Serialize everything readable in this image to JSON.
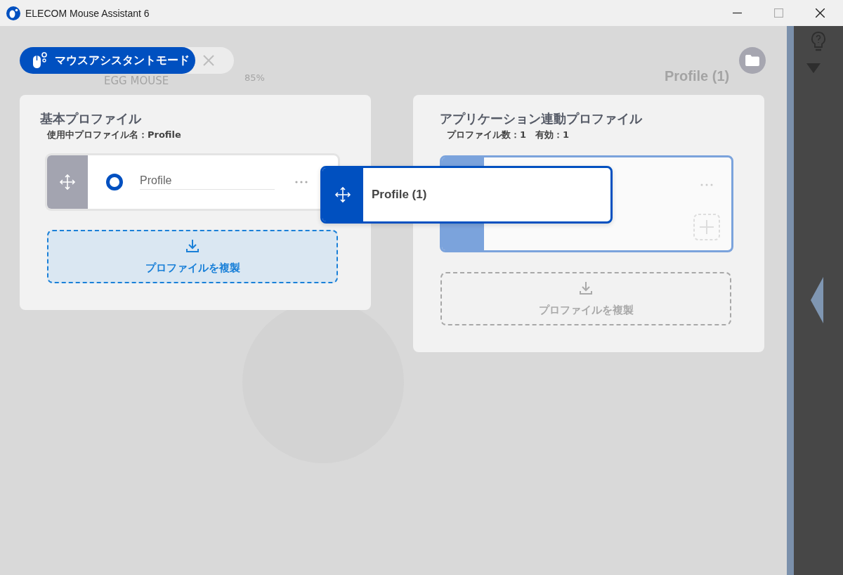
{
  "window": {
    "title": "ELECOM Mouse Assistant 6"
  },
  "background": {
    "device_name": "EGG MOUSE",
    "battery": "85%",
    "profile_name": "Profile (1)"
  },
  "mode_tab": {
    "label": "マウスアシスタントモード",
    "selected": true
  },
  "basic_profile": {
    "title": "基本プロファイル",
    "subtitle": "使用中プロファイル名：Profile",
    "items": [
      {
        "name": "Profile",
        "selected": true
      }
    ],
    "duplicate": {
      "label": "プロファイルを複製",
      "disabled": false
    }
  },
  "app_profile": {
    "title": "アプリケーション連動プロファイル",
    "subtitle": "プロファイル数：1　有効：1",
    "items": [
      {
        "selected": true
      }
    ],
    "duplicate": {
      "label": "プロファイルを複製",
      "disabled": true
    }
  },
  "drag_preview": {
    "label": "Profile (1)"
  }
}
